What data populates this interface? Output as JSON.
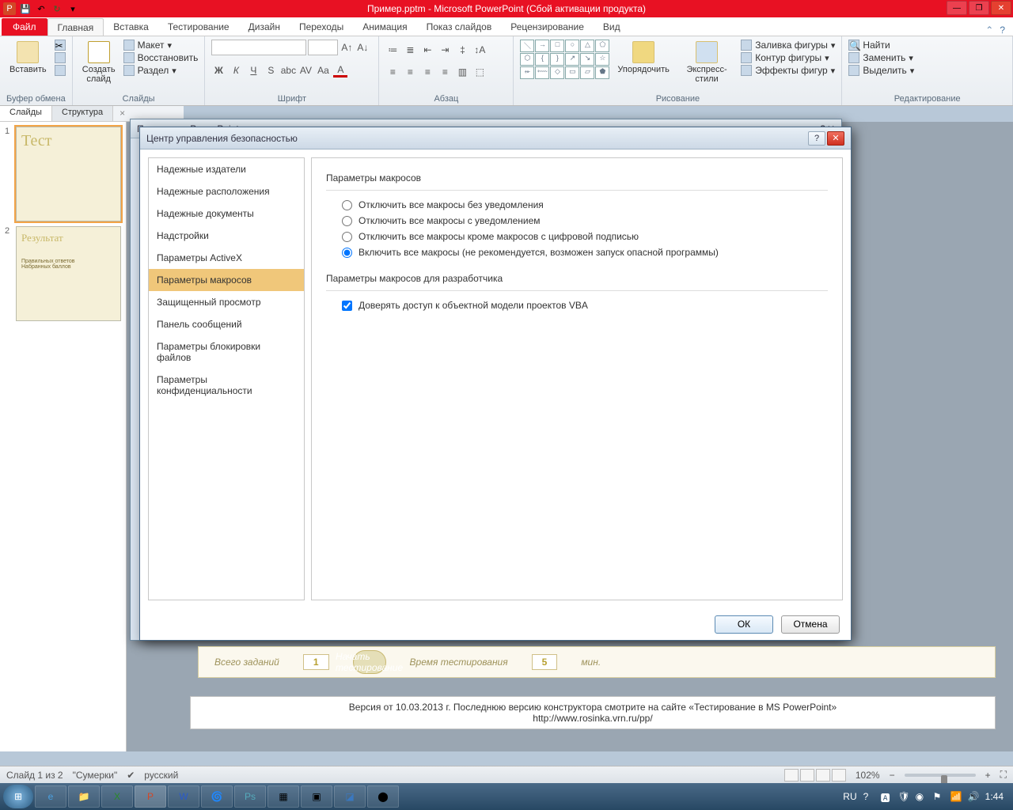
{
  "titlebar": {
    "title": "Пример.pptm - Microsoft PowerPoint (Сбой активации продукта)"
  },
  "ribbon": {
    "file": "Файл",
    "tabs": [
      "Главная",
      "Вставка",
      "Тестирование",
      "Дизайн",
      "Переходы",
      "Анимация",
      "Показ слайдов",
      "Рецензирование",
      "Вид"
    ],
    "active_tab_index": 0,
    "groups": {
      "clipboard": {
        "paste": "Вставить",
        "label": "Буфер обмена"
      },
      "slides": {
        "new": "Создать\nслайд",
        "layout": "Макет",
        "reset": "Восстановить",
        "section": "Раздел",
        "label": "Слайды"
      },
      "font": {
        "label": "Шрифт"
      },
      "para": {
        "label": "Абзац"
      },
      "drawing": {
        "arrange": "Упорядочить",
        "quick": "Экспресс-стили",
        "fill": "Заливка фигуры",
        "outline": "Контур фигуры",
        "effects": "Эффекты фигур",
        "label": "Рисование"
      },
      "editing": {
        "find": "Найти",
        "replace": "Заменить",
        "select": "Выделить",
        "label": "Редактирование"
      }
    }
  },
  "panel_tabs": {
    "slides": "Слайды",
    "structure": "Структура"
  },
  "thumbs": {
    "slide1_title": "Тест",
    "slide2_title": "Результат",
    "slide2_line1": "Правильных ответов",
    "slide2_line2": "Набранных баллов"
  },
  "dialog_back": {
    "title": "Параметры PowerPoint"
  },
  "dialog": {
    "title": "Центр управления безопасностью",
    "nav": [
      "Надежные издатели",
      "Надежные расположения",
      "Надежные документы",
      "Надстройки",
      "Параметры ActiveX",
      "Параметры макросов",
      "Защищенный просмотр",
      "Панель сообщений",
      "Параметры блокировки файлов",
      "Параметры конфиденциальности"
    ],
    "nav_active_index": 5,
    "section1": "Параметры макросов",
    "radios": [
      "Отключить все макросы без уведомления",
      "Отключить все макросы с уведомлением",
      "Отключить все макросы кроме макросов с цифровой подписью",
      "Включить все макросы (не рекомендуется, возможен запуск опасной программы)"
    ],
    "radio_selected_index": 3,
    "section2": "Параметры макросов для разработчика",
    "checkbox": "Доверять доступ к объектной модели проектов VBA",
    "checkbox_checked": true,
    "ok": "ОК",
    "cancel": "Отмена"
  },
  "slide_strip": {
    "total_tasks_label": "Всего заданий",
    "total_tasks_value": "1",
    "start": "Начать тестирование",
    "time_label": "Время тестирования",
    "time_value": "5",
    "time_unit": "мин."
  },
  "version_strip": {
    "line1": "Версия от 10.03.2013 г. Последнюю версию конструктора смотрите на сайте «Тестирование в MS PowerPoint»",
    "line2": "http://www.rosinka.vrn.ru/pp/"
  },
  "status": {
    "slide": "Слайд 1 из 2",
    "theme": "\"Сумерки\"",
    "lang": "русский",
    "zoom": "102%"
  },
  "taskbar": {
    "lang": "RU",
    "clock": "1:44"
  }
}
